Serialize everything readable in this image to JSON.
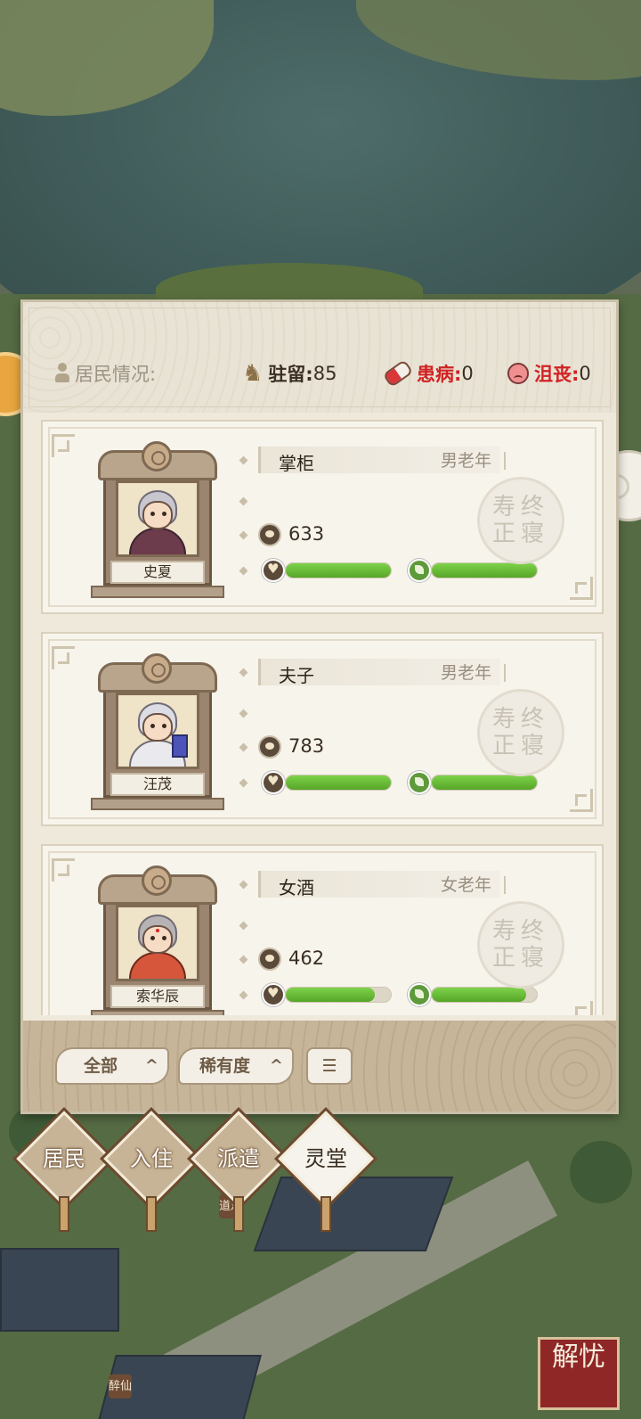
{
  "status": {
    "label": "居民情况:",
    "stay_label": "驻留:",
    "stay_value": "85",
    "sick_label": "患病:",
    "sick_value": "0",
    "depressed_label": "沮丧:",
    "depressed_value": "0"
  },
  "residents": [
    {
      "name": "史夏",
      "job": "掌柜",
      "category": "男老年",
      "wealth": "633",
      "health_ratio": 1.0,
      "mood_ratio": 1.0,
      "seal_top": "寿终",
      "seal_bottom": "正寝"
    },
    {
      "name": "汪茂",
      "job": "夫子",
      "category": "男老年",
      "wealth": "783",
      "health_ratio": 1.0,
      "mood_ratio": 1.0,
      "seal_top": "寿终",
      "seal_bottom": "正寝"
    },
    {
      "name": "索华辰",
      "job": "女酒",
      "category": "女老年",
      "wealth": "462",
      "health_ratio": 0.85,
      "mood_ratio": 0.9,
      "seal_top": "寿终",
      "seal_bottom": "正寝"
    }
  ],
  "filters": {
    "all_label": "全部",
    "rarity_label": "稀有度",
    "arrow": "^",
    "sort_icon": "sort-icon"
  },
  "nav": {
    "residents": "居民",
    "move_in": "入住",
    "dispatch": "派遣",
    "memorial": "灵堂"
  },
  "map_signs": {
    "taoist_temple": "道观",
    "drunk_immortal": "醉仙"
  },
  "corner_badge": "解忧",
  "colors": {
    "bar_green": "#56a628",
    "warning_red": "#d12222",
    "panel_bg": "#efe9dc"
  }
}
